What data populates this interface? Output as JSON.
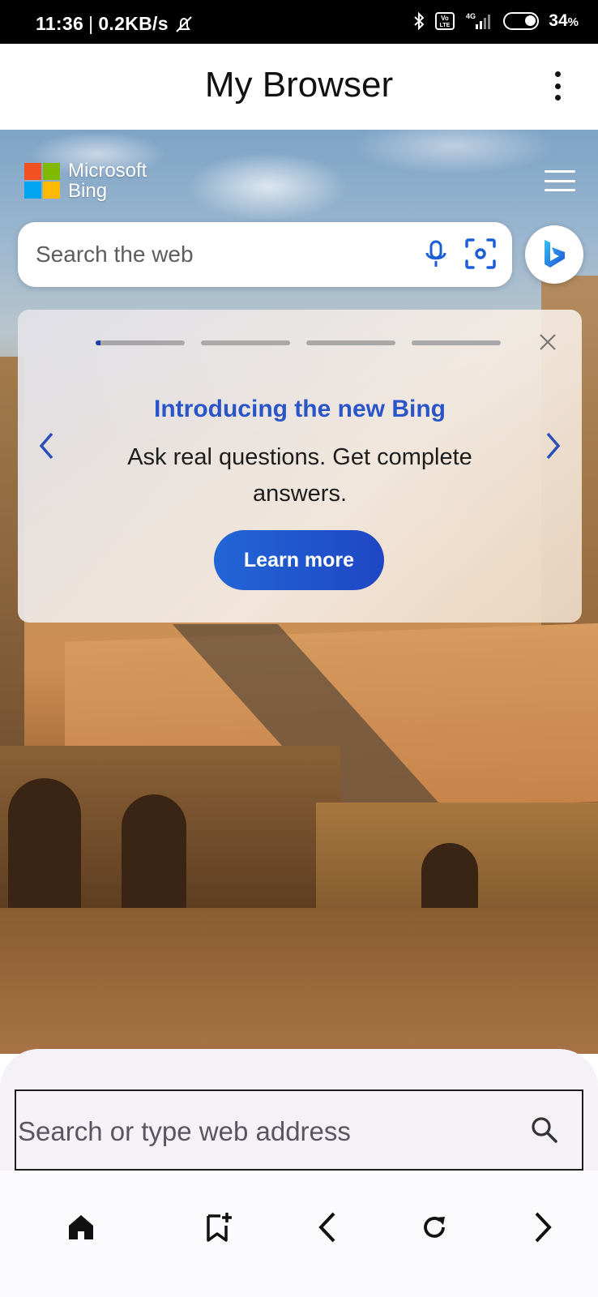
{
  "status_bar": {
    "time": "11:36",
    "net_speed": "0.2KB/s",
    "network": "4G",
    "volte": "Vo LTE",
    "battery": "34",
    "battery_unit": "%"
  },
  "app_bar": {
    "title": "My Browser"
  },
  "bing": {
    "logo_line1": "Microsoft",
    "logo_line2": "Bing",
    "search_placeholder": "Search the web",
    "logo_colors": [
      "#f25022",
      "#7fba00",
      "#00a4ef",
      "#ffb900"
    ]
  },
  "promo": {
    "heading": "Introducing the new Bing",
    "body": "Ask real questions. Get complete answers.",
    "button": "Learn more",
    "pages": 4,
    "active_page": 1
  },
  "address_bar": {
    "placeholder": "Search or type web address"
  },
  "nav": {
    "icons": [
      "home-icon",
      "bookmark-add-icon",
      "back-icon",
      "reload-icon",
      "forward-icon"
    ]
  },
  "colors": {
    "accent": "#2a55c9",
    "button": "#1f46c4"
  }
}
